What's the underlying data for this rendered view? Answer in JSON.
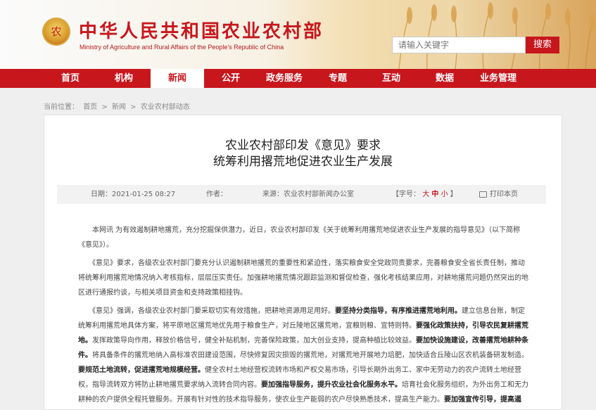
{
  "header": {
    "emblem_text": "农",
    "title": "中华人民共和国农业农村部",
    "subtitle": "Ministry of Agriculture and Rural Affairs of the People's Republic of China",
    "search_placeholder": "请输入关键字",
    "search_button": "搜索"
  },
  "nav": {
    "items": [
      "首页",
      "机构",
      "新闻",
      "公开",
      "政务服务",
      "专题",
      "互动",
      "数据",
      "业务管理"
    ],
    "active_index": 2
  },
  "breadcrumb": {
    "prefix": "当前位置：",
    "items": [
      "首页",
      "新闻",
      "农业农村部动态"
    ],
    "separator": ">"
  },
  "article": {
    "title_line1": "农业农村部印发《意见》要求",
    "title_line2": "统筹利用撂荒地促进农业生产发展",
    "meta": {
      "date_label": "日期：",
      "date": "2021-01-25 08:27",
      "author_label": "作者：",
      "author": "",
      "source_label": "来源：",
      "source": "农业农村部新闻办公室",
      "font_label_open": "【字号：",
      "font_large": "大",
      "font_medium": "中",
      "font_small": "小",
      "font_label_close": "】",
      "print": "打印本页"
    },
    "paragraphs": [
      [
        "　　本网讯 为有效遏制耕地撂荒，充分挖掘保供潜力，近日，农业农村部印发《关于统筹利用撂荒地促进农业生产发展的指导意见》（以下简称",
        "《意见》）。"
      ],
      [
        "　　《意见》要求，各级农业农村部门要充分认识遏制耕地撂荒的重要性和紧迫性，落实粮食安全党政同责要求，完善粮食安全省长责任制，推动",
        "将统筹利用撂荒地情况纳入考核指标，层层压实责任。加强耕地撂荒情况跟踪监测和督促检查，强化考核结果应用，对耕地撂荒问题仍然突出的地",
        "区进行通报约谈，与相关项目资金和支持政策相挂钩。"
      ]
    ],
    "rich_lines": [
      [
        {
          "t": "　　《意见》强调，各级农业农村部门要采取切实有效措施，把耕地资源用足用好。"
        },
        {
          "t": "要坚持分类指导，有序推进撂荒地利用。",
          "b": true
        },
        {
          "t": "建立信息台账，制定"
        }
      ],
      [
        {
          "t": "统筹利用撂荒地具体方案，将平原地区撂荒地优先用于粮食生产，对丘陵地区撂荒地，宜粮则粮、宜特则特。"
        },
        {
          "t": "要强化政策扶持，引导农民复耕撂荒",
          "b": true
        }
      ],
      [
        {
          "t": "地。",
          "b": true
        },
        {
          "t": "发挥政策导向作用，释放价格信号，健全补贴机制，完善保险政策，加大创业支持，提高种植比较效益。"
        },
        {
          "t": "要加快设施建设，改善撂荒地耕种条",
          "b": true
        }
      ],
      [
        {
          "t": "件。",
          "b": true
        },
        {
          "t": "将具备条件的撂荒地纳入高标准农田建设范围，尽快修复因灾损毁的撂荒地，对撂荒地开展地力培肥，加快适合丘陵山区农机装备研发制造。"
        }
      ],
      [
        {
          "t": "要规范土地流转，促进撂荒地规模经营。",
          "b": true
        },
        {
          "t": "健全农村土地经营权流转市场和产权交易市场，引导长期外出务工、家中无劳动力的农户流转土地经营"
        }
      ],
      [
        {
          "t": "权，指导流转双方将防止耕地撂荒要求纳入流转合同内容。"
        },
        {
          "t": "要加强指导服务，提升农业社会化服务水平。",
          "b": true
        },
        {
          "t": "培育社会化服务组织，为外出务工和无力"
        }
      ],
      [
        {
          "t": "耕种的农户提供全程托管服务。开展有针对性的技术指导服务，使农业生产能弱的农户尽快熟悉技术，提高生产能力。"
        },
        {
          "t": "要加强宣传引导，提高遏",
          "b": true
        }
      ]
    ]
  }
}
